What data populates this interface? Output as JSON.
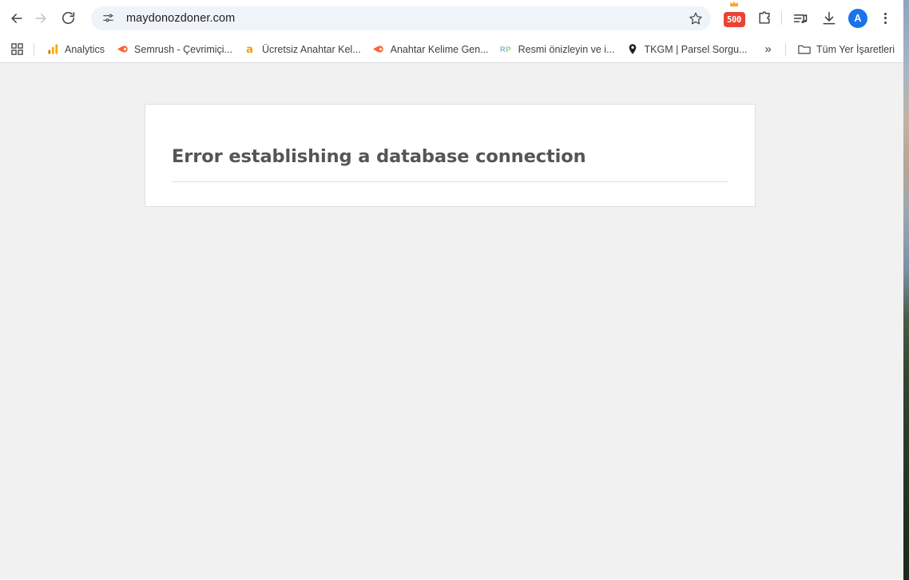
{
  "browser": {
    "nav": {
      "back_label": "Back",
      "forward_label": "Forward",
      "reload_label": "Reload"
    },
    "omnibox": {
      "site_info_icon": "tune-sliders-icon",
      "url": "maydonozdoner.com",
      "placeholder": "Search Google or type a URL",
      "bookmark_star_label": "Bookmark this tab"
    },
    "toolbar_icons": [
      {
        "name": "extension-badge-500",
        "label": "500",
        "color": "#ea4335"
      },
      {
        "name": "extensions-puzzle-icon",
        "label": "Extensions"
      },
      {
        "name": "media-playlist-icon",
        "label": "Media controls"
      },
      {
        "name": "downloads-icon",
        "label": "Downloads"
      },
      {
        "name": "profile-avatar",
        "label": "A",
        "color": "#1a73e8"
      },
      {
        "name": "chrome-menu-icon",
        "label": "Customize and control Google Chrome"
      }
    ]
  },
  "bookmarks": {
    "apps_label": "Apps",
    "items": [
      {
        "label": "Analytics",
        "icon": "google-analytics-icon"
      },
      {
        "label": "Semrush - Çevrimiçi...",
        "icon": "semrush-icon"
      },
      {
        "label": "Ücretsiz Anahtar Kel...",
        "icon": "amazon-a-icon"
      },
      {
        "label": "Anahtar Kelime Gen...",
        "icon": "semrush-icon"
      },
      {
        "label": "Resmi önizleyin ve i...",
        "icon": "rp-icon"
      },
      {
        "label": "TKGM | Parsel Sorgu...",
        "icon": "map-pin-icon"
      }
    ],
    "overflow_label": "»",
    "all_bookmarks": {
      "label": "Tüm Yer İşaretleri",
      "icon": "folder-icon"
    }
  },
  "page": {
    "background_color": "#f1f1f1",
    "error": {
      "title": "Error establishing a database connection"
    }
  }
}
